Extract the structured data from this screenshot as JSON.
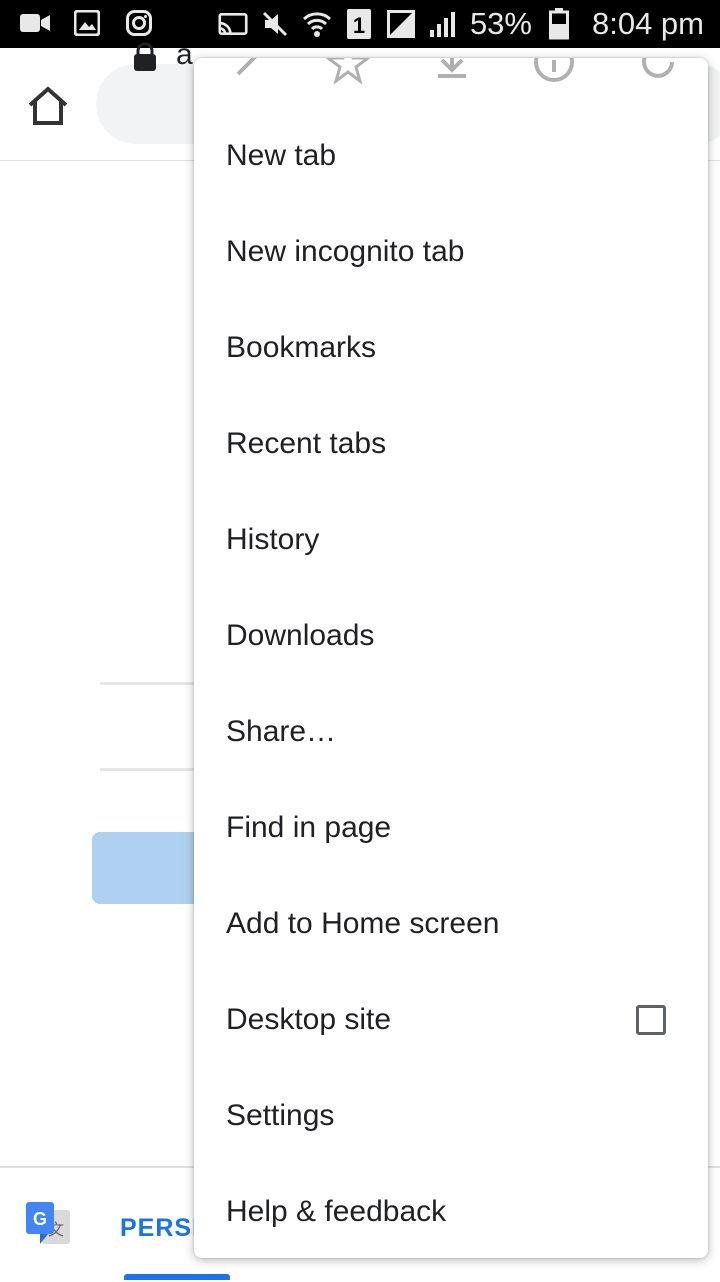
{
  "status_bar": {
    "battery_percent": "53%",
    "time": "8:04 pm",
    "sim_slot": "1",
    "icons_left": [
      "video-camera-icon",
      "gallery-icon",
      "instagram-icon"
    ],
    "icons_right": [
      "cast-icon",
      "mute-icon",
      "wifi-icon",
      "sim-icon",
      "signal-icon",
      "battery-icon"
    ]
  },
  "toolbar": {
    "url_text": "a"
  },
  "menu": {
    "top_icons": [
      "forward-icon",
      "bookmark-star-icon",
      "download-icon",
      "page-info-icon",
      "refresh-icon"
    ],
    "items": [
      {
        "label": "New tab"
      },
      {
        "label": "New incognito tab"
      },
      {
        "label": "Bookmarks"
      },
      {
        "label": "Recent tabs"
      },
      {
        "label": "History"
      },
      {
        "label": "Downloads"
      },
      {
        "label": "Share…"
      },
      {
        "label": "Find in page"
      },
      {
        "label": "Add to Home screen"
      },
      {
        "label": "Desktop site",
        "checked": false
      },
      {
        "label": "Settings"
      },
      {
        "label": "Help & feedback"
      }
    ]
  },
  "translate_bar": {
    "label": "PERSI"
  },
  "colors": {
    "accent": "#1a73e8",
    "status_bar_bg": "#000000",
    "menu_text": "#202124"
  }
}
